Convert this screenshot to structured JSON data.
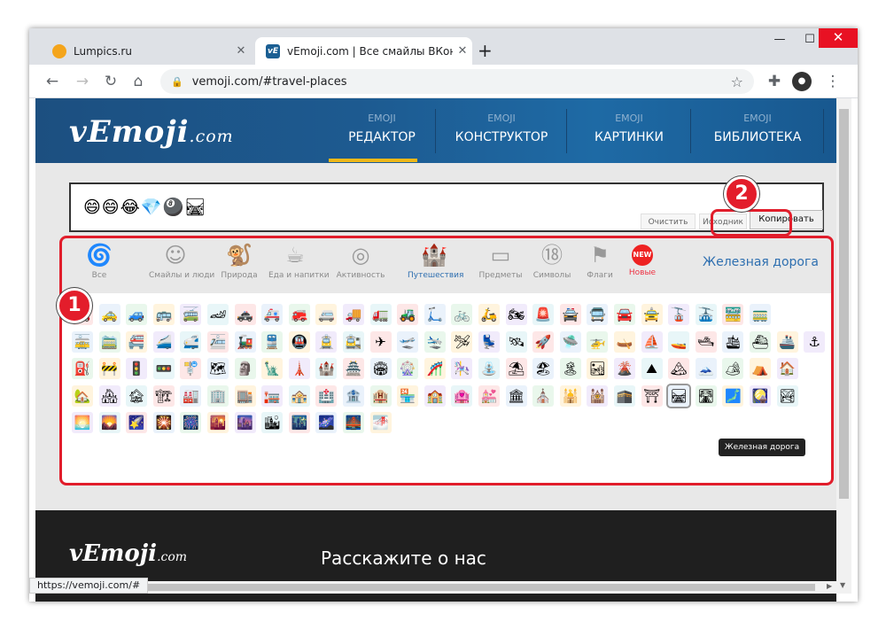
{
  "browser": {
    "tabs": [
      {
        "title": "Lumpics.ru"
      },
      {
        "title": "vEmoji.com | Все смайлы ВКонта"
      }
    ],
    "new_tab": "+",
    "url": "vemoji.com/#travel-places",
    "status_url": "https://vemoji.com/#"
  },
  "site": {
    "logo_main": "vEmoji",
    "logo_suffix": ".com",
    "nav": [
      {
        "kicker": "EMOJI",
        "label": "РЕДАКТОР"
      },
      {
        "kicker": "EMOJI",
        "label": "КОНСТРУКТОР"
      },
      {
        "kicker": "EMOJI",
        "label": "КАРТИНКИ"
      },
      {
        "kicker": "EMOJI",
        "label": "БИБЛИОТЕКА"
      }
    ]
  },
  "editor": {
    "content": "😄😄😂💎🎱🛤",
    "clear_label": "Очистить",
    "source_label": "Исходник",
    "copy_label": "Копировать"
  },
  "annotations": {
    "badge1": "1",
    "badge2": "2"
  },
  "categories": [
    {
      "label": "Все",
      "icon": "🌀"
    },
    {
      "label": "Смайлы и люди",
      "icon": "☺"
    },
    {
      "label": "Природа",
      "icon": "🐒"
    },
    {
      "label": "Еда и напитки",
      "icon": "☕"
    },
    {
      "label": "Активность",
      "icon": "◎"
    },
    {
      "label": "Путешествия",
      "icon": "🏰"
    },
    {
      "label": "Предметы",
      "icon": "▭"
    },
    {
      "label": "Символы",
      "icon": "⑱"
    },
    {
      "label": "Флаги",
      "icon": "⚑"
    },
    {
      "label": "Новые",
      "icon": "NEW"
    }
  ],
  "selected_category_label": "Железная дорога",
  "tooltip": "Железная дорога",
  "emoji_grid": [
    [
      "🚗",
      "🚕",
      "🚙",
      "🚌",
      "🚎",
      "🏎",
      "🚓",
      "🚑",
      "🚒",
      "🚐",
      "🚚",
      "🚛",
      "🚜",
      "🛴",
      "🚲",
      "🛵",
      "🏍",
      "🚨",
      "🚔",
      "🚍",
      "🚘",
      "🚖",
      "🚡",
      "🚠",
      "🚟",
      "🚃"
    ],
    [
      "🚋",
      "🚞",
      "🚝",
      "🚄",
      "🚅",
      "🚈",
      "🚂",
      "🚆",
      "🚇",
      "🚊",
      "🚉",
      "✈",
      "🛫",
      "🛬",
      "🛩",
      "💺",
      "🛰",
      "🚀",
      "🛸",
      "🚁",
      "🛶",
      "⛵",
      "🚤",
      "🛥",
      "🛳",
      "⛴",
      "🚢",
      "⚓"
    ],
    [
      "⛽",
      "🚧",
      "🚦",
      "🚥",
      "🚏",
      "🗺",
      "🗿",
      "🗽",
      "🗼",
      "🏰",
      "🏯",
      "🏟",
      "🎡",
      "🎢",
      "🎠",
      "⛲",
      "⛱",
      "🏖",
      "🏝",
      "🏜",
      "🌋",
      "⛰",
      "🏔",
      "🗻",
      "🏕",
      "⛺",
      "🏠"
    ],
    [
      "🏡",
      "🏘",
      "🏚",
      "🏗",
      "🏭",
      "🏢",
      "🏬",
      "🏣",
      "🏤",
      "🏥",
      "🏦",
      "🏨",
      "🏪",
      "🏫",
      "🏩",
      "💒",
      "🏛",
      "⛪",
      "🕌",
      "🕍",
      "🕋",
      "⛩",
      "🛤",
      "🛣",
      "🗾",
      "🎑",
      "🏞"
    ],
    [
      "🌅",
      "🌄",
      "🌠",
      "🎇",
      "🎆",
      "🌇",
      "🌆",
      "🏙",
      "🌃",
      "🌌",
      "🌉",
      "🌁"
    ]
  ]
}
